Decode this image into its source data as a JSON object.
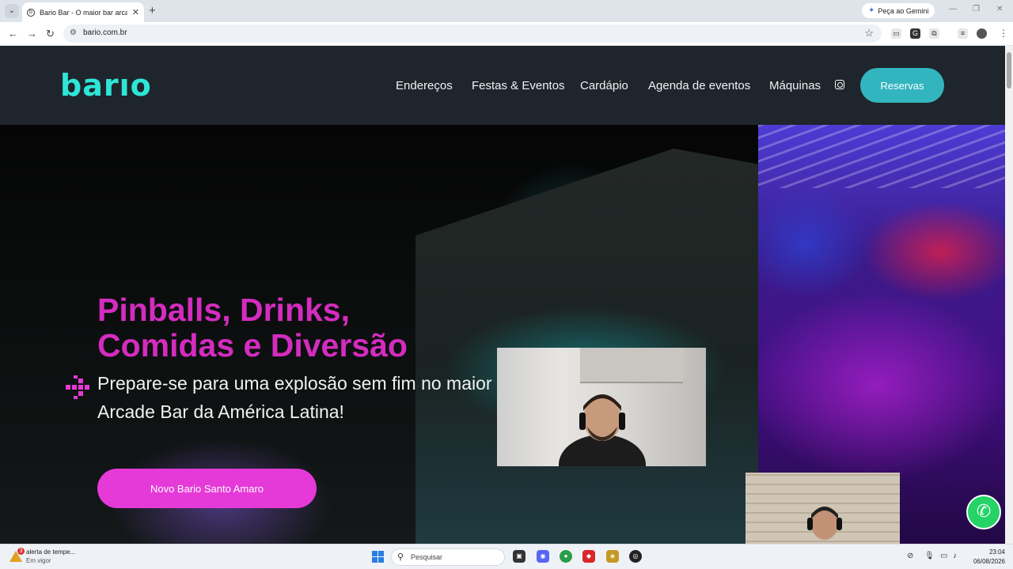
{
  "browser": {
    "tab_title": "Bario Bar - O maior bar arcade",
    "new_tab_label": "+",
    "gemini_label": "Peça ao Gemini",
    "url": "bario.com.br"
  },
  "site": {
    "logo_text": "barıo",
    "nav": [
      "Endereços",
      "Festas & Eventos",
      "Cardápio",
      "Agenda de eventos",
      "Máquinas"
    ],
    "reserve_label": "Reservas",
    "accent_color": "#33b5bf",
    "brand_color": "#2ee6d6"
  },
  "hero": {
    "title_line1": "Pinballs, Drinks,",
    "title_line2": "Comidas e Diversão",
    "subtitle": "Prepare-se para uma explosão sem fim no maior Arcade Bar da América Latina!",
    "cta_label": "Novo Bario Santo Amaro",
    "title_color": "#d42cbf",
    "cta_color": "#e53ad8"
  },
  "taskbar": {
    "weather_title": "alerta de tempe...",
    "weather_sub": "Em vigor",
    "weather_badge": "3",
    "search_placeholder": "Pesquisar",
    "time": "23:04",
    "date": "06/08/2026"
  }
}
